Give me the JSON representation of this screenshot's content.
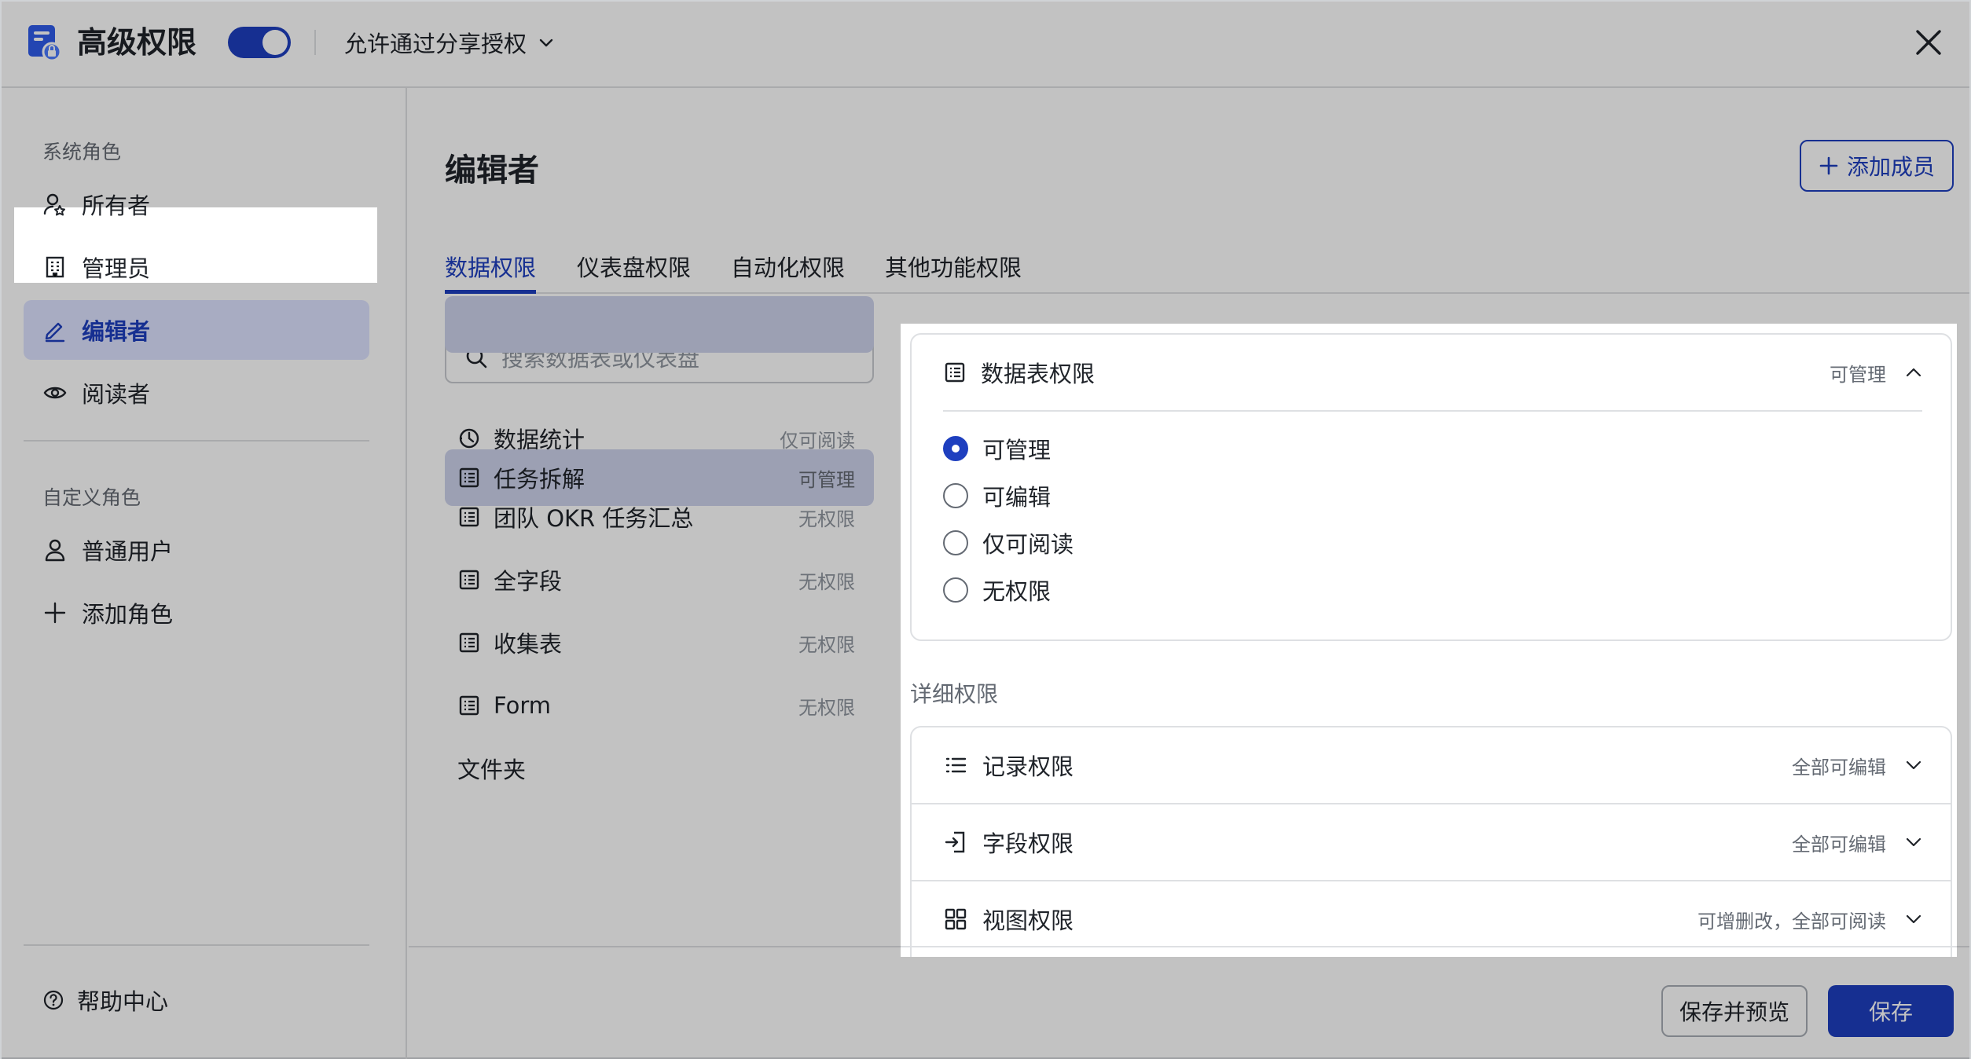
{
  "header": {
    "title": "高级权限",
    "share_option": "允许通过分享授权"
  },
  "sidebar": {
    "system_roles_label": "系统角色",
    "system_roles": [
      {
        "label": "所有者",
        "icon": "owner-icon"
      },
      {
        "label": "管理员",
        "icon": "building-icon"
      },
      {
        "label": "编辑者",
        "icon": "pencil-icon",
        "active": true
      },
      {
        "label": "阅读者",
        "icon": "eye-icon"
      }
    ],
    "custom_roles_label": "自定义角色",
    "custom_roles": [
      {
        "label": "普通用户",
        "icon": "user-icon"
      },
      {
        "label": "添加角色",
        "icon": "plus-icon"
      }
    ],
    "help_label": "帮助中心"
  },
  "main": {
    "role_title": "编辑者",
    "add_member_label": "添加成员",
    "tabs": [
      {
        "label": "数据权限",
        "active": true
      },
      {
        "label": "仪表盘权限"
      },
      {
        "label": "自动化权限"
      },
      {
        "label": "其他功能权限"
      }
    ],
    "search_placeholder": "搜索数据表或仪表盘",
    "tables": [
      {
        "name": "数据统计",
        "perm": "仅可阅读",
        "icon": "dashboard-icon"
      },
      {
        "name": "任务拆解",
        "perm": "可管理",
        "icon": "table-icon",
        "active": true
      },
      {
        "name": "团队 OKR 任务汇总",
        "perm": "无权限",
        "icon": "table-icon"
      },
      {
        "name": "全字段",
        "perm": "无权限",
        "icon": "table-icon"
      },
      {
        "name": "收集表",
        "perm": "无权限",
        "icon": "table-icon"
      },
      {
        "name": "Form",
        "perm": "无权限",
        "icon": "table-icon"
      }
    ],
    "folder_label": "文件夹",
    "table_permission": {
      "title": "数据表权限",
      "current": "可管理",
      "options": [
        "可管理",
        "可编辑",
        "仅可阅读",
        "无权限"
      ],
      "selected_index": 0
    },
    "detail_label": "详细权限",
    "details": [
      {
        "title": "记录权限",
        "value": "全部可编辑",
        "icon": "list-icon"
      },
      {
        "title": "字段权限",
        "value": "全部可编辑",
        "icon": "field-icon"
      },
      {
        "title": "视图权限",
        "value": "可增删改，全部可阅读",
        "icon": "grid-icon"
      }
    ]
  },
  "footer": {
    "save_preview_label": "保存并预览",
    "save_label": "保存"
  },
  "colors": {
    "accent": "#1e3fbf",
    "active_bg": "#dde3ff"
  }
}
